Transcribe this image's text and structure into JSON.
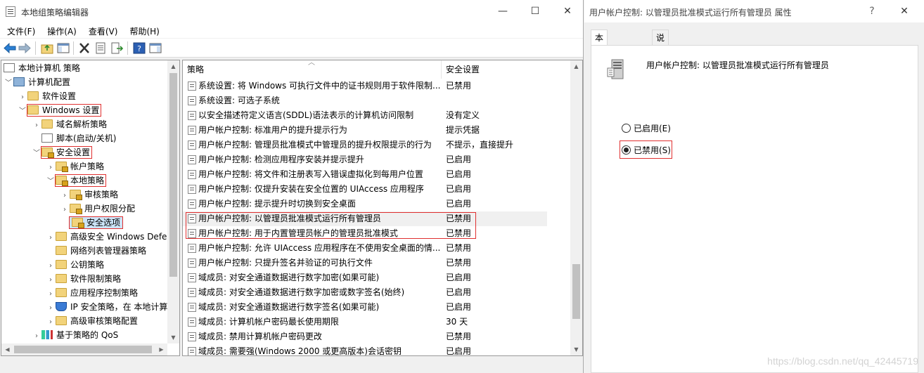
{
  "main_window": {
    "title": "本地组策略编辑器",
    "controls": {
      "minimize": "—",
      "maximize": "☐",
      "close": "✕"
    }
  },
  "menu": [
    "文件(F)",
    "操作(A)",
    "查看(V)",
    "帮助(H)"
  ],
  "tree": {
    "items": [
      {
        "label": "本地计算机 策略",
        "icon": "doc-icon"
      },
      {
        "label": "计算机配置",
        "icon": "computer-icon"
      },
      {
        "label": "软件设置",
        "icon": "folder-icon"
      },
      {
        "label": "Windows 设置",
        "icon": "folder-icon"
      },
      {
        "label": "域名解析策略",
        "icon": "folder-icon"
      },
      {
        "label": "脚本(启动/关机)",
        "icon": "doc-icon"
      },
      {
        "label": "安全设置",
        "icon": "folder-lock-icon"
      },
      {
        "label": "帐户策略",
        "icon": "folder-lock-icon"
      },
      {
        "label": "本地策略",
        "icon": "folder-lock-icon"
      },
      {
        "label": "审核策略",
        "icon": "folder-lock-icon"
      },
      {
        "label": "用户权限分配",
        "icon": "folder-lock-icon"
      },
      {
        "label": "安全选项",
        "icon": "folder-lock-icon"
      },
      {
        "label": "高级安全 Windows Defe",
        "icon": "folder-icon"
      },
      {
        "label": "网络列表管理器策略",
        "icon": "folder-icon"
      },
      {
        "label": "公钥策略",
        "icon": "folder-icon"
      },
      {
        "label": "软件限制策略",
        "icon": "folder-icon"
      },
      {
        "label": "应用程序控制策略",
        "icon": "folder-icon"
      },
      {
        "label": "IP 安全策略，在 本地计算",
        "icon": "shield-icon"
      },
      {
        "label": "高级审核策略配置",
        "icon": "folder-icon"
      },
      {
        "label": "基于策略的 QoS",
        "icon": "chart-icon"
      }
    ]
  },
  "list": {
    "columns": {
      "policy": "策略",
      "setting": "安全设置"
    },
    "rows": [
      {
        "name": "系统设置: 将 Windows 可执行文件中的证书规则用于软件限制...",
        "value": "已禁用"
      },
      {
        "name": "系统设置: 可选子系统",
        "value": ""
      },
      {
        "name": "以安全描述符定义语言(SDDL)语法表示的计算机访问限制",
        "value": "没有定义"
      },
      {
        "name": "用户帐户控制: 标准用户的提升提示行为",
        "value": "提示凭据"
      },
      {
        "name": "用户帐户控制: 管理员批准模式中管理员的提升权限提示的行为",
        "value": "不提示，直接提升"
      },
      {
        "name": "用户帐户控制: 检测应用程序安装并提示提升",
        "value": "已启用"
      },
      {
        "name": "用户帐户控制: 将文件和注册表写入错误虚拟化到每用户位置",
        "value": "已启用"
      },
      {
        "name": "用户帐户控制: 仅提升安装在安全位置的 UIAccess 应用程序",
        "value": "已启用"
      },
      {
        "name": "用户帐户控制: 提示提升时切换到安全桌面",
        "value": "已启用"
      },
      {
        "name": "用户帐户控制: 以管理员批准模式运行所有管理员",
        "value": "已禁用"
      },
      {
        "name": "用户帐户控制: 用于内置管理员帐户的管理员批准模式",
        "value": "已禁用"
      },
      {
        "name": "用户帐户控制: 允许 UIAccess 应用程序在不使用安全桌面的情...",
        "value": "已禁用"
      },
      {
        "name": "用户帐户控制: 只提升签名并验证的可执行文件",
        "value": "已禁用"
      },
      {
        "name": "域成员: 对安全通道数据进行数字加密(如果可能)",
        "value": "已启用"
      },
      {
        "name": "域成员: 对安全通道数据进行数字加密或数字签名(始终)",
        "value": "已启用"
      },
      {
        "name": "域成员: 对安全通道数据进行数字签名(如果可能)",
        "value": "已启用"
      },
      {
        "name": "域成员: 计算机帐户密码最长使用期限",
        "value": "30 天"
      },
      {
        "name": "域成员: 禁用计算机帐户密码更改",
        "value": "已禁用"
      },
      {
        "name": "域成员: 需要强(Windows 2000 或更高版本)会话密钥",
        "value": "已启用"
      }
    ]
  },
  "dialog": {
    "title": "用户帐户控制: 以管理员批准模式运行所有管理员 属性",
    "help": "?",
    "close": "✕",
    "tabs": [
      "本地安全设置",
      "说明"
    ],
    "heading": "用户帐户控制: 以管理员批准模式运行所有管理员",
    "options": [
      {
        "label": "已启用(E)",
        "checked": false
      },
      {
        "label": "已禁用(S)",
        "checked": true
      }
    ]
  },
  "watermark": "https://blog.csdn.net/qq_42445719"
}
